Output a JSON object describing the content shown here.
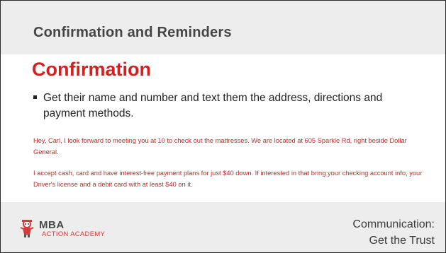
{
  "slide": {
    "title": "Confirmation and Reminders",
    "heading": "Confirmation",
    "bullet": "Get their name and number and text them the address, directions and payment methods.",
    "notes": [
      "Hey, Carl, I look forward to meeting you at 10 to check out the mattresses. We are located at 605 Sparkle Rd, right beside Dollar General.",
      "I accept cash, card and have interest-free payment plans for just $40 down. If interested in that bring your checking account info, your Driver's license and a debit card with at least $40 on it."
    ]
  },
  "footer": {
    "logo_main": "MBA",
    "logo_sub": "ACTION ACADEMY",
    "line1": "Communication:",
    "line2": "Get the Trust"
  },
  "colors": {
    "accent_red": "#d42020",
    "note_red": "#c62828",
    "band_gray": "#ededed"
  },
  "icons": [
    "mascot-logo-icon"
  ]
}
